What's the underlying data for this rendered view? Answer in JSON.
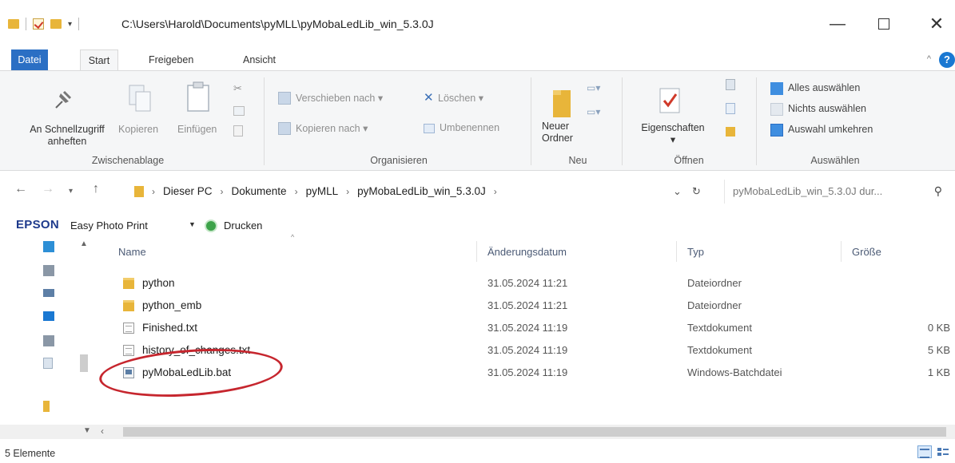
{
  "window": {
    "title": "C:\\Users\\Harold\\Documents\\pyMLL\\pyMobaLedLib_win_5.3.0J",
    "minimize_symbol": "—",
    "close_symbol": "✕"
  },
  "ribbon_tabs": [
    "Datei",
    "Start",
    "Freigeben",
    "Ansicht"
  ],
  "ribbon": {
    "zwischenablage": {
      "label": "Zwischenablage",
      "pin_label_1": "An Schnellzugriff",
      "pin_label_2": "anheften",
      "copy_label": "Kopieren",
      "paste_label": "Einfügen"
    },
    "organisieren": {
      "label": "Organisieren",
      "move_to": "Verschieben nach",
      "copy_to": "Kopieren nach",
      "delete": "Löschen",
      "rename": "Umbenennen"
    },
    "neu": {
      "label": "Neu",
      "new_folder_1": "Neuer",
      "new_folder_2": "Ordner"
    },
    "oeffnen": {
      "label": "Öffnen",
      "properties": "Eigenschaften"
    },
    "auswaehlen": {
      "label": "Auswählen",
      "select_all": "Alles auswählen",
      "select_none": "Nichts auswählen",
      "invert": "Auswahl umkehren"
    }
  },
  "address": {
    "breadcrumbs": [
      "Dieser PC",
      "Dokumente",
      "pyMLL",
      "pyMobaLedLib_win_5.3.0J"
    ],
    "search_placeholder": "pyMobaLedLib_win_5.3.0J dur..."
  },
  "epson": {
    "logo": "EPSON",
    "app": "Easy Photo Print",
    "print": "Drucken"
  },
  "columns": {
    "name": "Name",
    "date": "Änderungsdatum",
    "type": "Typ",
    "size": "Größe"
  },
  "files": [
    {
      "name": "python",
      "date": "31.05.2024 11:21",
      "type": "Dateiordner",
      "size": "",
      "icon": "folder-icon"
    },
    {
      "name": "python_emb",
      "date": "31.05.2024 11:21",
      "type": "Dateiordner",
      "size": "",
      "icon": "folder-icon"
    },
    {
      "name": "Finished.txt",
      "date": "31.05.2024 11:19",
      "type": "Textdokument",
      "size": "0 KB",
      "icon": "text-file-icon"
    },
    {
      "name": "history_of_changes.txt",
      "date": "31.05.2024 11:19",
      "type": "Textdokument",
      "size": "5 KB",
      "icon": "text-file-icon"
    },
    {
      "name": "pyMobaLedLib.bat",
      "date": "31.05.2024 11:19",
      "type": "Windows-Batchdatei",
      "size": "1 KB",
      "icon": "batch-file-icon"
    }
  ],
  "status": {
    "count": "5 Elemente"
  },
  "colors": {
    "accent": "#2b6fc4",
    "folder": "#e8b53a",
    "annotation": "#c6262e"
  }
}
